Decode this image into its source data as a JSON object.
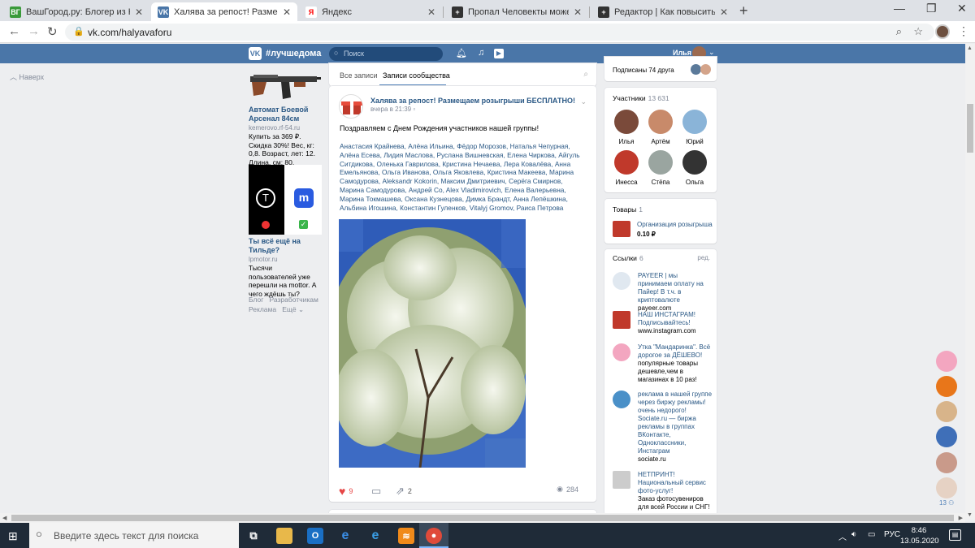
{
  "browser": {
    "tabs": [
      {
        "title": "ВашГород.ру: Блогер из Кемеро",
        "fav_text": "ВГ",
        "fav_color": "#3a9a3a"
      },
      {
        "title": "Халява за репост! Размещаем р",
        "fav_text": "VK",
        "fav_color": "#4a76a8"
      },
      {
        "title": "Яндекс",
        "fav_text": "Я",
        "fav_color": "#ffffff"
      },
      {
        "title": "Пропал Человекты можешь по",
        "fav_text": "+",
        "fav_color": "#333333"
      },
      {
        "title": "Редактор | Как повысить рейтин",
        "fav_text": "+",
        "fav_color": "#333333"
      }
    ],
    "url": "vk.com/halyavaforu"
  },
  "vk_header": {
    "logo": "VK",
    "tagline": "#лучшедома",
    "search_placeholder": "Поиск",
    "user_name": "Илья"
  },
  "left": {
    "up_label": "Наверх",
    "ads": [
      {
        "title": "Автомат Боевой Арсенал 84см",
        "domain": "kemerovo.rf-54.ru",
        "text": "Купить за 369 ₽. Скидка 30%! Вес, кг: 0,8. Возраст, лет: 12. Длина, см: 80."
      },
      {
        "title": "Ты всё ещё на Тильде?",
        "domain": "lpmotor.ru",
        "text": "Тысячи пользователей уже перешли на mottor. А чего ждёшь ты?"
      }
    ],
    "footer_links": [
      "Блог",
      "Разработчикам",
      "Реклама",
      "Ещё"
    ]
  },
  "feed": {
    "tabs": [
      "Все записи",
      "Записи сообщества"
    ],
    "post": {
      "author": "Халява за репост! Размещаем розыгрыши БЕСПЛАТНО!",
      "date": "вчера в 21:39",
      "text": "Поздравляем с Днем Рождения участников нашей группы!",
      "names": "Анастасия Крайнева, Алёна Ильина, Фёдор Морозов, Наталья Чепурная, Алёна Есева, Лидия Маслова, Руслана Вишневская, Елена Чиркова, Айгуль Ситдикова, Оленька Гаврилова, Кристина Нечаева, Лера Ковалёва, Анна Емельянова, Ольга Иванова, Ольга Яковлева, Кристина Макеева, Марина Самодурова, Aleksandr Kokorin, Максим Дмитриевич, Серёга Смирнов, Марина Самодурова, Андрей Co, Alex Vladimirovich, Елена Валерьевна, Марина Токмашева, Оксана Кузнецова, Димка Брандт, Анна Лепёшкина, Альбина Игошина, Константин Гуленков, Vitalyj Gromov, Раиса Петрова",
      "likes": "9",
      "shares": "2",
      "views": "284"
    }
  },
  "right": {
    "friends_label": "Подписаны 74 друга",
    "members_label": "Участники",
    "members_count": "13 631",
    "members": [
      {
        "name": "Илья",
        "color": "#7a4a3a"
      },
      {
        "name": "Артём",
        "color": "#c88a6a"
      },
      {
        "name": "Юрий",
        "color": "#8ab4d8"
      },
      {
        "name": "Инесса",
        "color": "#c0392b"
      },
      {
        "name": "Стёпа",
        "color": "#9aa5a0"
      },
      {
        "name": "Ольга",
        "color": "#333333"
      }
    ],
    "goods_label": "Товары",
    "goods_count": "1",
    "good_name": "Организация розыгрыша",
    "good_price": "0.10 ₽",
    "links_label": "Ссылки",
    "links_count": "6",
    "links_edit": "ред.",
    "links": [
      {
        "title": "PAYEER | мы принимаем оплату на Пайер! В т.ч. в криптовалюте",
        "domain": "payeer.com",
        "color": "#e0e8f0"
      },
      {
        "title": "НАШ ИНСТАГРАМ! Подписывайтесь!",
        "domain": "www.instagram.com",
        "color": "#c0392b"
      },
      {
        "title": "Утка \"Мандаринка\". Всё дорогое за ДЁШЕВО!",
        "domain": "популярные товары дешевле,чем в магазинах в 10 раз!",
        "color": "#f3a6c0"
      },
      {
        "title": "реклама в нашей группе через биржу рекламы! очень недорого!",
        "domain": "Sociate.ru — биржа рекламы в группах ВКонтакте, Одноклассники, Инстаграм",
        "domain2": "sociate.ru",
        "color": "#4a90c8"
      },
      {
        "title": "НЕТПРИНТ! Национальный сервис фото-услуг!",
        "domain": "Заказ фотосувениров для всей России и СНГ!",
        "color": "#cccccc"
      }
    ],
    "rail_count": "13"
  },
  "taskbar": {
    "search_placeholder": "Введите здесь текст для поиска",
    "lang": "РУС",
    "time": "8:46",
    "date": "13.05.2020"
  },
  "colors": {
    "vk_blue": "#4a76a8",
    "link": "#2a5885",
    "like_red": "#e64646"
  }
}
